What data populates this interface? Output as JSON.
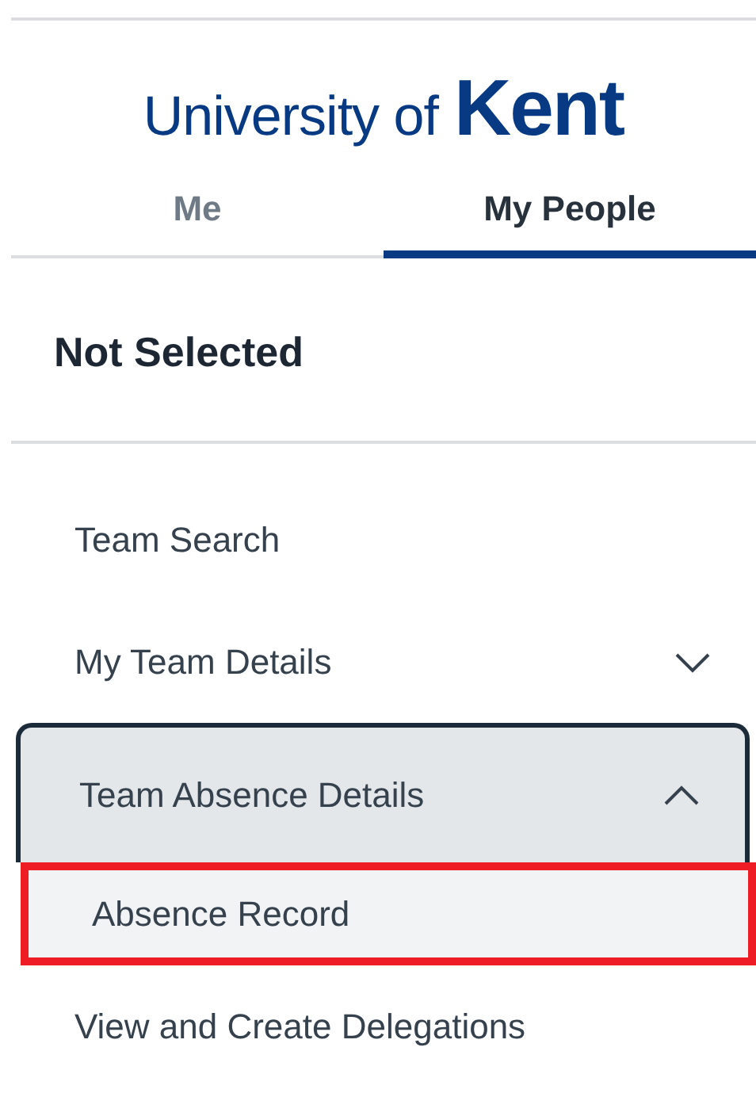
{
  "logo": {
    "text": "University of",
    "wordmark": "Kent"
  },
  "tabs": [
    {
      "label": "Me",
      "selected": false
    },
    {
      "label": "My People",
      "selected": true
    }
  ],
  "selection": "Not Selected",
  "menu": [
    {
      "kind": "link",
      "label": "Team Search"
    },
    {
      "kind": "group",
      "label": "My Team Details",
      "expanded": false,
      "focused": false
    },
    {
      "kind": "group",
      "label": "Team Absence Details",
      "expanded": true,
      "focused": true,
      "children": [
        {
          "label": "Absence Record",
          "highlighted": true
        }
      ]
    },
    {
      "kind": "link",
      "label": "View and Create Delegations"
    }
  ]
}
